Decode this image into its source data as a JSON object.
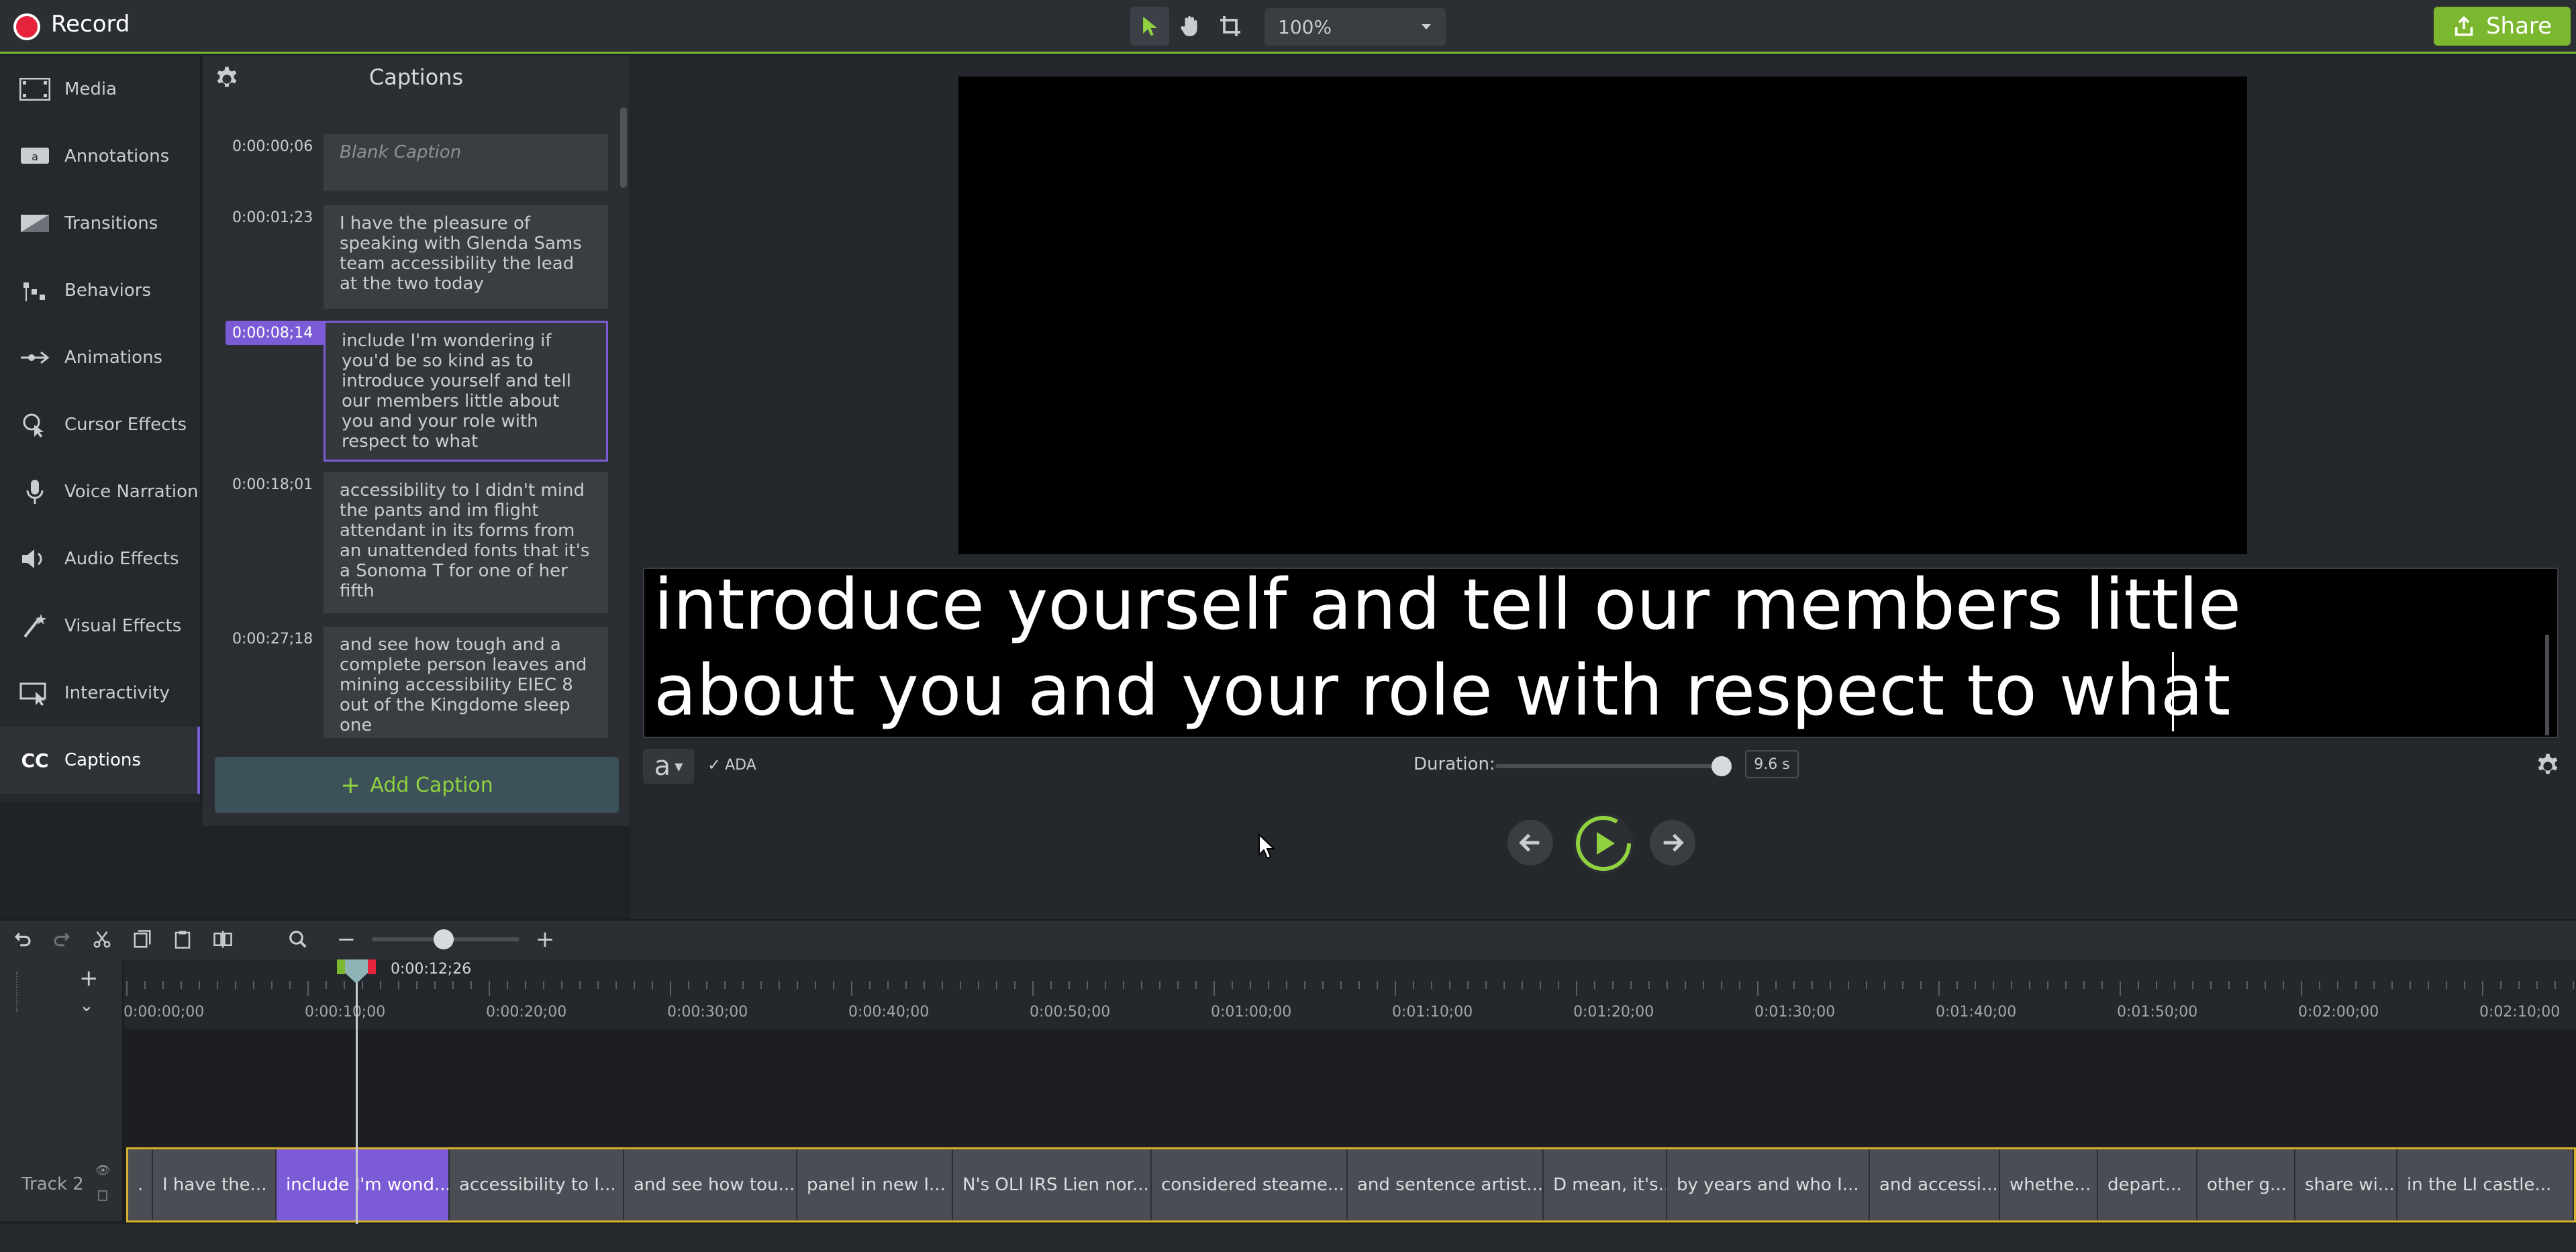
{
  "topbar": {
    "record_label": "Record",
    "zoom_value": "100%",
    "share_label": "Share",
    "accent_color": "#7cb82f",
    "record_color": "#e5233b"
  },
  "sidebar": {
    "items": [
      {
        "label": "Media",
        "icon": "film-strip-icon"
      },
      {
        "label": "Annotations",
        "icon": "annotation-icon"
      },
      {
        "label": "Transitions",
        "icon": "transition-icon"
      },
      {
        "label": "Behaviors",
        "icon": "behaviors-icon"
      },
      {
        "label": "Animations",
        "icon": "animation-arrow-icon"
      },
      {
        "label": "Cursor Effects",
        "icon": "cursor-effects-icon"
      },
      {
        "label": "Voice Narration",
        "icon": "microphone-icon"
      },
      {
        "label": "Audio Effects",
        "icon": "speaker-icon"
      },
      {
        "label": "Visual Effects",
        "icon": "magic-wand-icon"
      },
      {
        "label": "Interactivity",
        "icon": "interactivity-icon"
      },
      {
        "label": "Captions",
        "icon": "cc-icon",
        "active": true
      }
    ]
  },
  "captions_panel": {
    "title": "Captions",
    "add_label": "Add Caption",
    "entries": [
      {
        "time": "0:00:00;06",
        "text": "Blank Caption",
        "placeholder": true
      },
      {
        "time": "0:00:01;23",
        "text": "I have the pleasure of speaking with Glenda Sams team accessibility the lead at the two today"
      },
      {
        "time": "0:00:08;14",
        "text": "include I'm wondering if you'd be so kind as to introduce yourself and tell our members little about you and your role with respect to what",
        "active": true
      },
      {
        "time": "0:00:18;01",
        "text": "accessibility to I didn't mind the pants and im flight attendant in its forms from an unattended fonts that it's a Sonoma T for one of her fifth"
      },
      {
        "time": "0:00:27;18",
        "text": "and see how tough and a complete person leaves and mining accessibility EIEC 8 out of the Kingdome sleep one"
      }
    ],
    "active_color": "#7c5cd6"
  },
  "canvas": {
    "caption_line1": "introduce yourself and tell our members little",
    "caption_line2": "about you and your role with respect to what",
    "font_glyph": "a",
    "ada_label": "ADA",
    "duration_label": "Duration:",
    "duration_value": "9.6 s"
  },
  "timeline": {
    "playhead_time": "0:00:12;26",
    "ticks": [
      "0:00:00;00",
      "0:00:10;00",
      "0:00:20;00",
      "0:00:30;00",
      "0:00:40;00",
      "0:00:50;00",
      "0:01:00;00",
      "0:01:10;00",
      "0:01:20;00",
      "0:01:30;00",
      "0:01:40;00",
      "0:01:50;00",
      "0:02:00;00",
      "0:02:10;00"
    ],
    "track_label": "Track 2",
    "clips": [
      {
        "label": "."
      },
      {
        "label": "I have the..."
      },
      {
        "label": "include I'm wond...",
        "active": true
      },
      {
        "label": "accessibility to I..."
      },
      {
        "label": "and see how tou..."
      },
      {
        "label": "panel in new I..."
      },
      {
        "label": "N's OLI IRS Lien nor..."
      },
      {
        "label": "considered steame..."
      },
      {
        "label": "and sentence artist..."
      },
      {
        "label": "D mean, it's..."
      },
      {
        "label": "by years and who I..."
      },
      {
        "label": "and accessi..."
      },
      {
        "label": "whethe..."
      },
      {
        "label": "depart..."
      },
      {
        "label": "other g..."
      },
      {
        "label": "share wi..."
      },
      {
        "label": "in the LI castle..."
      }
    ],
    "track_border_color": "#d6b02c"
  }
}
